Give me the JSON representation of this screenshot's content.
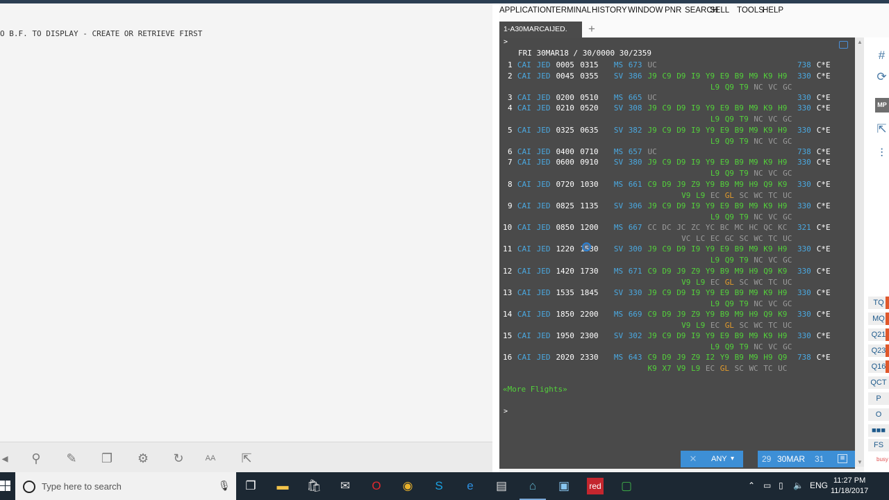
{
  "left_pane": {
    "message": "O B.F. TO DISPLAY - CREATE OR RETRIEVE FIRST",
    "tools": [
      {
        "name": "back-tool-icon",
        "glyph": "◂"
      },
      {
        "name": "search-tool-icon",
        "glyph": "⚲"
      },
      {
        "name": "edit-pencil-icon",
        "glyph": "✎"
      },
      {
        "name": "copy-icon",
        "glyph": "❐"
      },
      {
        "name": "settings-gear-icon",
        "glyph": "⚙"
      },
      {
        "name": "refresh-icon",
        "glyph": "↻"
      },
      {
        "name": "font-size-icon",
        "glyph": "AA"
      },
      {
        "name": "external-link-icon",
        "glyph": "⇱"
      }
    ]
  },
  "menu": [
    "APPLICATION",
    "TERMINAL",
    "HISTORY",
    "WINDOW",
    "PNR",
    "SEARCH",
    "SELL",
    "TOOLS",
    "HELP"
  ],
  "tab": {
    "label": "1-A30MARCAIJED.",
    "add_glyph": "+"
  },
  "terminal": {
    "prompt": ">",
    "header": "FRI 30MAR18 / 30/0000 30/2359",
    "flights": [
      {
        "n": "1",
        "from": "CAI",
        "to": "JED",
        "dep": "0005",
        "arr": "0315",
        "al": "MS",
        "fno": "673",
        "classes": [
          [
            "UC",
            "gr"
          ]
        ],
        "eq": "738",
        "fl": "C*E"
      },
      {
        "n": "2",
        "from": "CAI",
        "to": "JED",
        "dep": "0045",
        "arr": "0355",
        "al": "SV",
        "fno": "386",
        "classes": [
          [
            "J9",
            "g"
          ],
          [
            "C9",
            "g"
          ],
          [
            "D9",
            "g"
          ],
          [
            "I9",
            "g"
          ],
          [
            "Y9",
            "g"
          ],
          [
            "E9",
            "g"
          ],
          [
            "B9",
            "g"
          ],
          [
            "M9",
            "g"
          ],
          [
            "K9",
            "g"
          ],
          [
            "H9",
            "g"
          ]
        ],
        "classes2": [
          [
            "L9",
            "g"
          ],
          [
            "Q9",
            "g"
          ],
          [
            "T9",
            "g"
          ],
          [
            "NC",
            "gr"
          ],
          [
            "VC",
            "gr"
          ],
          [
            "GC",
            "gr"
          ]
        ],
        "eq": "330",
        "fl": "C*E"
      },
      {
        "n": "3",
        "from": "CAI",
        "to": "JED",
        "dep": "0200",
        "arr": "0510",
        "al": "MS",
        "fno": "665",
        "classes": [
          [
            "UC",
            "gr"
          ]
        ],
        "eq": "330",
        "fl": "C*E"
      },
      {
        "n": "4",
        "from": "CAI",
        "to": "JED",
        "dep": "0210",
        "arr": "0520",
        "al": "SV",
        "fno": "308",
        "classes": [
          [
            "J9",
            "g"
          ],
          [
            "C9",
            "g"
          ],
          [
            "D9",
            "g"
          ],
          [
            "I9",
            "g"
          ],
          [
            "Y9",
            "g"
          ],
          [
            "E9",
            "g"
          ],
          [
            "B9",
            "g"
          ],
          [
            "M9",
            "g"
          ],
          [
            "K9",
            "g"
          ],
          [
            "H9",
            "g"
          ]
        ],
        "classes2": [
          [
            "L9",
            "g"
          ],
          [
            "Q9",
            "g"
          ],
          [
            "T9",
            "g"
          ],
          [
            "NC",
            "gr"
          ],
          [
            "VC",
            "gr"
          ],
          [
            "GC",
            "gr"
          ]
        ],
        "eq": "330",
        "fl": "C*E"
      },
      {
        "n": "5",
        "from": "CAI",
        "to": "JED",
        "dep": "0325",
        "arr": "0635",
        "al": "SV",
        "fno": "382",
        "classes": [
          [
            "J9",
            "g"
          ],
          [
            "C9",
            "g"
          ],
          [
            "D9",
            "g"
          ],
          [
            "I9",
            "g"
          ],
          [
            "Y9",
            "g"
          ],
          [
            "E9",
            "g"
          ],
          [
            "B9",
            "g"
          ],
          [
            "M9",
            "g"
          ],
          [
            "K9",
            "g"
          ],
          [
            "H9",
            "g"
          ]
        ],
        "classes2": [
          [
            "L9",
            "g"
          ],
          [
            "Q9",
            "g"
          ],
          [
            "T9",
            "g"
          ],
          [
            "NC",
            "gr"
          ],
          [
            "VC",
            "gr"
          ],
          [
            "GC",
            "gr"
          ]
        ],
        "eq": "330",
        "fl": "C*E"
      },
      {
        "n": "6",
        "from": "CAI",
        "to": "JED",
        "dep": "0400",
        "arr": "0710",
        "al": "MS",
        "fno": "657",
        "classes": [
          [
            "UC",
            "gr"
          ]
        ],
        "eq": "738",
        "fl": "C*E"
      },
      {
        "n": "7",
        "from": "CAI",
        "to": "JED",
        "dep": "0600",
        "arr": "0910",
        "al": "SV",
        "fno": "380",
        "classes": [
          [
            "J9",
            "g"
          ],
          [
            "C9",
            "g"
          ],
          [
            "D9",
            "g"
          ],
          [
            "I9",
            "g"
          ],
          [
            "Y9",
            "g"
          ],
          [
            "E9",
            "g"
          ],
          [
            "B9",
            "g"
          ],
          [
            "M9",
            "g"
          ],
          [
            "K9",
            "g"
          ],
          [
            "H9",
            "g"
          ]
        ],
        "classes2": [
          [
            "L9",
            "g"
          ],
          [
            "Q9",
            "g"
          ],
          [
            "T9",
            "g"
          ],
          [
            "NC",
            "gr"
          ],
          [
            "VC",
            "gr"
          ],
          [
            "GC",
            "gr"
          ]
        ],
        "eq": "330",
        "fl": "C*E"
      },
      {
        "n": "8",
        "from": "CAI",
        "to": "JED",
        "dep": "0720",
        "arr": "1030",
        "al": "MS",
        "fno": "661",
        "classes": [
          [
            "C9",
            "g"
          ],
          [
            "D9",
            "g"
          ],
          [
            "J9",
            "g"
          ],
          [
            "Z9",
            "g"
          ],
          [
            "Y9",
            "g"
          ],
          [
            "B9",
            "g"
          ],
          [
            "M9",
            "g"
          ],
          [
            "H9",
            "g"
          ],
          [
            "Q9",
            "g"
          ],
          [
            "K9",
            "g"
          ]
        ],
        "classes2b": [
          [
            "V9",
            "g"
          ],
          [
            "L9",
            "g"
          ],
          [
            "EC",
            "gr"
          ],
          [
            "GL",
            "o"
          ],
          [
            "SC",
            "gr"
          ],
          [
            "WC",
            "gr"
          ],
          [
            "TC",
            "gr"
          ],
          [
            "UC",
            "gr"
          ]
        ],
        "eq": "330",
        "fl": "C*E"
      },
      {
        "n": "9",
        "from": "CAI",
        "to": "JED",
        "dep": "0825",
        "arr": "1135",
        "al": "SV",
        "fno": "306",
        "classes": [
          [
            "J9",
            "g"
          ],
          [
            "C9",
            "g"
          ],
          [
            "D9",
            "g"
          ],
          [
            "I9",
            "g"
          ],
          [
            "Y9",
            "g"
          ],
          [
            "E9",
            "g"
          ],
          [
            "B9",
            "g"
          ],
          [
            "M9",
            "g"
          ],
          [
            "K9",
            "g"
          ],
          [
            "H9",
            "g"
          ]
        ],
        "classes2": [
          [
            "L9",
            "g"
          ],
          [
            "Q9",
            "g"
          ],
          [
            "T9",
            "g"
          ],
          [
            "NC",
            "gr"
          ],
          [
            "VC",
            "gr"
          ],
          [
            "GC",
            "gr"
          ]
        ],
        "eq": "330",
        "fl": "C*E"
      },
      {
        "n": "10",
        "from": "CAI",
        "to": "JED",
        "dep": "0850",
        "arr": "1200",
        "al": "MS",
        "fno": "667",
        "classes": [
          [
            "CC",
            "gr"
          ],
          [
            "DC",
            "gr"
          ],
          [
            "JC",
            "gr"
          ],
          [
            "ZC",
            "gr"
          ],
          [
            "YC",
            "gr"
          ],
          [
            "BC",
            "gr"
          ],
          [
            "MC",
            "gr"
          ],
          [
            "HC",
            "gr"
          ],
          [
            "QC",
            "gr"
          ],
          [
            "KC",
            "gr"
          ]
        ],
        "classes2b": [
          [
            "VC",
            "gr"
          ],
          [
            "LC",
            "gr"
          ],
          [
            "EC",
            "gr"
          ],
          [
            "GC",
            "gr"
          ],
          [
            "SC",
            "gr"
          ],
          [
            "WC",
            "gr"
          ],
          [
            "TC",
            "gr"
          ],
          [
            "UC",
            "gr"
          ]
        ],
        "eq": "321",
        "fl": "C*E"
      },
      {
        "n": "11",
        "from": "CAI",
        "to": "JED",
        "dep": "1220",
        "arr": "1530",
        "al": "SV",
        "fno": "300",
        "classes": [
          [
            "J9",
            "g"
          ],
          [
            "C9",
            "g"
          ],
          [
            "D9",
            "g"
          ],
          [
            "I9",
            "g"
          ],
          [
            "Y9",
            "g"
          ],
          [
            "E9",
            "g"
          ],
          [
            "B9",
            "g"
          ],
          [
            "M9",
            "g"
          ],
          [
            "K9",
            "g"
          ],
          [
            "H9",
            "g"
          ]
        ],
        "classes2": [
          [
            "L9",
            "g"
          ],
          [
            "Q9",
            "g"
          ],
          [
            "T9",
            "g"
          ],
          [
            "NC",
            "gr"
          ],
          [
            "VC",
            "gr"
          ],
          [
            "GC",
            "gr"
          ]
        ],
        "eq": "330",
        "fl": "C*E"
      },
      {
        "n": "12",
        "from": "CAI",
        "to": "JED",
        "dep": "1420",
        "arr": "1730",
        "al": "MS",
        "fno": "671",
        "classes": [
          [
            "C9",
            "g"
          ],
          [
            "D9",
            "g"
          ],
          [
            "J9",
            "g"
          ],
          [
            "Z9",
            "g"
          ],
          [
            "Y9",
            "g"
          ],
          [
            "B9",
            "g"
          ],
          [
            "M9",
            "g"
          ],
          [
            "H9",
            "g"
          ],
          [
            "Q9",
            "g"
          ],
          [
            "K9",
            "g"
          ]
        ],
        "classes2b": [
          [
            "V9",
            "g"
          ],
          [
            "L9",
            "g"
          ],
          [
            "EC",
            "gr"
          ],
          [
            "GL",
            "o"
          ],
          [
            "SC",
            "gr"
          ],
          [
            "WC",
            "gr"
          ],
          [
            "TC",
            "gr"
          ],
          [
            "UC",
            "gr"
          ]
        ],
        "eq": "330",
        "fl": "C*E"
      },
      {
        "n": "13",
        "from": "CAI",
        "to": "JED",
        "dep": "1535",
        "arr": "1845",
        "al": "SV",
        "fno": "330",
        "classes": [
          [
            "J9",
            "g"
          ],
          [
            "C9",
            "g"
          ],
          [
            "D9",
            "g"
          ],
          [
            "I9",
            "g"
          ],
          [
            "Y9",
            "g"
          ],
          [
            "E9",
            "g"
          ],
          [
            "B9",
            "g"
          ],
          [
            "M9",
            "g"
          ],
          [
            "K9",
            "g"
          ],
          [
            "H9",
            "g"
          ]
        ],
        "classes2": [
          [
            "L9",
            "g"
          ],
          [
            "Q9",
            "g"
          ],
          [
            "T9",
            "g"
          ],
          [
            "NC",
            "gr"
          ],
          [
            "VC",
            "gr"
          ],
          [
            "GC",
            "gr"
          ]
        ],
        "eq": "330",
        "fl": "C*E"
      },
      {
        "n": "14",
        "from": "CAI",
        "to": "JED",
        "dep": "1850",
        "arr": "2200",
        "al": "MS",
        "fno": "669",
        "classes": [
          [
            "C9",
            "g"
          ],
          [
            "D9",
            "g"
          ],
          [
            "J9",
            "g"
          ],
          [
            "Z9",
            "g"
          ],
          [
            "Y9",
            "g"
          ],
          [
            "B9",
            "g"
          ],
          [
            "M9",
            "g"
          ],
          [
            "H9",
            "g"
          ],
          [
            "Q9",
            "g"
          ],
          [
            "K9",
            "g"
          ]
        ],
        "classes2b": [
          [
            "V9",
            "g"
          ],
          [
            "L9",
            "g"
          ],
          [
            "EC",
            "gr"
          ],
          [
            "GL",
            "o"
          ],
          [
            "SC",
            "gr"
          ],
          [
            "WC",
            "gr"
          ],
          [
            "TC",
            "gr"
          ],
          [
            "UC",
            "gr"
          ]
        ],
        "eq": "330",
        "fl": "C*E"
      },
      {
        "n": "15",
        "from": "CAI",
        "to": "JED",
        "dep": "1950",
        "arr": "2300",
        "al": "SV",
        "fno": "302",
        "classes": [
          [
            "J9",
            "g"
          ],
          [
            "C9",
            "g"
          ],
          [
            "D9",
            "g"
          ],
          [
            "I9",
            "g"
          ],
          [
            "Y9",
            "g"
          ],
          [
            "E9",
            "g"
          ],
          [
            "B9",
            "g"
          ],
          [
            "M9",
            "g"
          ],
          [
            "K9",
            "g"
          ],
          [
            "H9",
            "g"
          ]
        ],
        "classes2": [
          [
            "L9",
            "g"
          ],
          [
            "Q9",
            "g"
          ],
          [
            "T9",
            "g"
          ],
          [
            "NC",
            "gr"
          ],
          [
            "VC",
            "gr"
          ],
          [
            "GC",
            "gr"
          ]
        ],
        "eq": "330",
        "fl": "C*E"
      },
      {
        "n": "16",
        "from": "CAI",
        "to": "JED",
        "dep": "2020",
        "arr": "2330",
        "al": "MS",
        "fno": "643",
        "classes": [
          [
            "C9",
            "g"
          ],
          [
            "D9",
            "g"
          ],
          [
            "J9",
            "g"
          ],
          [
            "Z9",
            "g"
          ],
          [
            "I2",
            "g"
          ],
          [
            "Y9",
            "g"
          ],
          [
            "B9",
            "g"
          ],
          [
            "M9",
            "g"
          ],
          [
            "H9",
            "g"
          ],
          [
            "Q9",
            "g"
          ]
        ],
        "classes2c": [
          [
            "K9",
            "g"
          ],
          [
            "X7",
            "g"
          ],
          [
            "V9",
            "g"
          ],
          [
            "L9",
            "g"
          ],
          [
            "EC",
            "gr"
          ],
          [
            "GL",
            "o"
          ],
          [
            "SC",
            "gr"
          ],
          [
            "WC",
            "gr"
          ],
          [
            "TC",
            "gr"
          ],
          [
            "UC",
            "gr"
          ]
        ],
        "eq": "738",
        "fl": "C*E"
      }
    ],
    "more": "«More Flights»",
    "prompt2": ">"
  },
  "statusbar": {
    "clear": "✕",
    "airline": "ANY",
    "prev_day": "29",
    "date": "30MAR",
    "next_day": "31",
    "calendar": "▦"
  },
  "right_strip": {
    "icons": [
      "#",
      "⟳",
      "⇱",
      "⫶"
    ],
    "mp": "MP",
    "buttons": [
      "TQ",
      "MQ",
      "Q21",
      "Q23",
      "Q16",
      "QCT",
      "P",
      "O",
      "■■■",
      "FS"
    ],
    "busy": "busy"
  },
  "taskbar": {
    "search_placeholder": "Type here to search",
    "lang": "ENG",
    "time": "11:27 PM",
    "date": "11/18/2017"
  },
  "colors": {
    "terminal_bg": "#4a4a4a",
    "green": "#53d13b",
    "blue": "#4aa8e0",
    "grey": "#9b9b9b",
    "orange": "#e39b2b",
    "accent": "#3d8fd6"
  }
}
